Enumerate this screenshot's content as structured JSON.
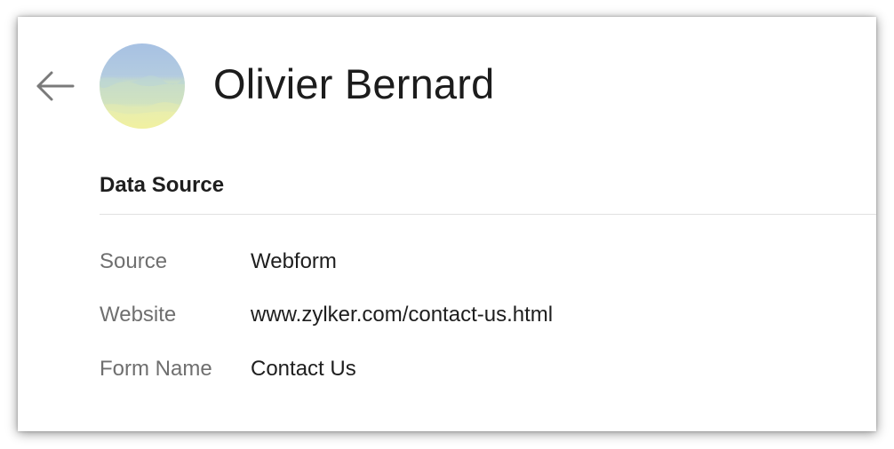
{
  "header": {
    "back_icon": "arrow-left-icon",
    "contact_name": "Olivier Bernard",
    "avatar_colors": [
      "#a9c3e2",
      "#c4dcc8",
      "#eef0a2"
    ]
  },
  "data_source": {
    "title": "Data Source",
    "fields": [
      {
        "label": "Source",
        "value": "Webform"
      },
      {
        "label": "Website",
        "value": "www.zylker.com/contact-us.html"
      },
      {
        "label": "Form Name",
        "value": "Contact Us"
      }
    ]
  },
  "colors": {
    "label": "#6f6f6f",
    "text": "#1e1e1e",
    "divider": "#e1e1e1"
  }
}
